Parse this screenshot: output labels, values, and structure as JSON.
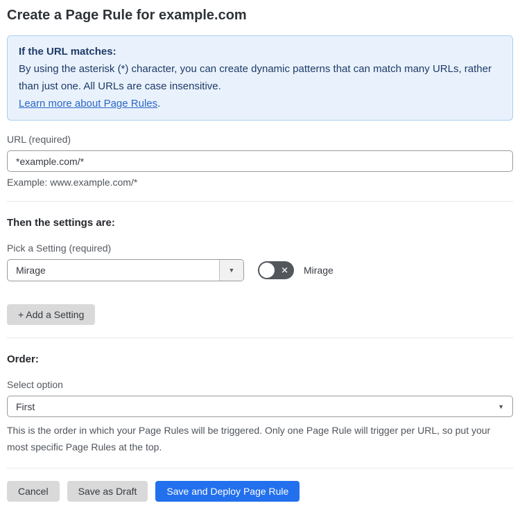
{
  "page": {
    "title": "Create a Page Rule for example.com"
  },
  "info_box": {
    "heading": "If the URL matches:",
    "body": "By using the asterisk (*) character, you can create dynamic patterns that can match many URLs, rather than just one. All URLs are case insensitive.",
    "link_label": "Learn more about Page Rules",
    "link_suffix": "."
  },
  "url_field": {
    "label": "URL (required)",
    "value": "*example.com/*",
    "helper": "Example: www.example.com/*"
  },
  "settings_section": {
    "heading": "Then the settings are:",
    "picker_label": "Pick a Setting (required)",
    "picker_value": "Mirage",
    "toggle_label": "Mirage",
    "toggle_state": "off",
    "add_button_label": "+ Add a Setting"
  },
  "order_section": {
    "heading": "Order:",
    "select_label": "Select option",
    "select_value": "First",
    "helper": "This is the order in which your Page Rules will be triggered. Only one Page Rule will trigger per URL, so put your most specific Page Rules at the top."
  },
  "footer": {
    "cancel_label": "Cancel",
    "save_draft_label": "Save as Draft",
    "save_deploy_label": "Save and Deploy Page Rule"
  },
  "icons": {
    "toggle_off_x": "✕",
    "dropdown_arrow": "▼",
    "select_arrow": "▼"
  },
  "colors": {
    "accent_blue": "#2270ed",
    "info_bg": "#e9f2fc",
    "info_border": "#aacdf1",
    "info_text": "#1e3a68",
    "link_blue": "#2b66c6",
    "toggle_off_bg": "#53575c",
    "button_gray": "#d9d9d9"
  }
}
